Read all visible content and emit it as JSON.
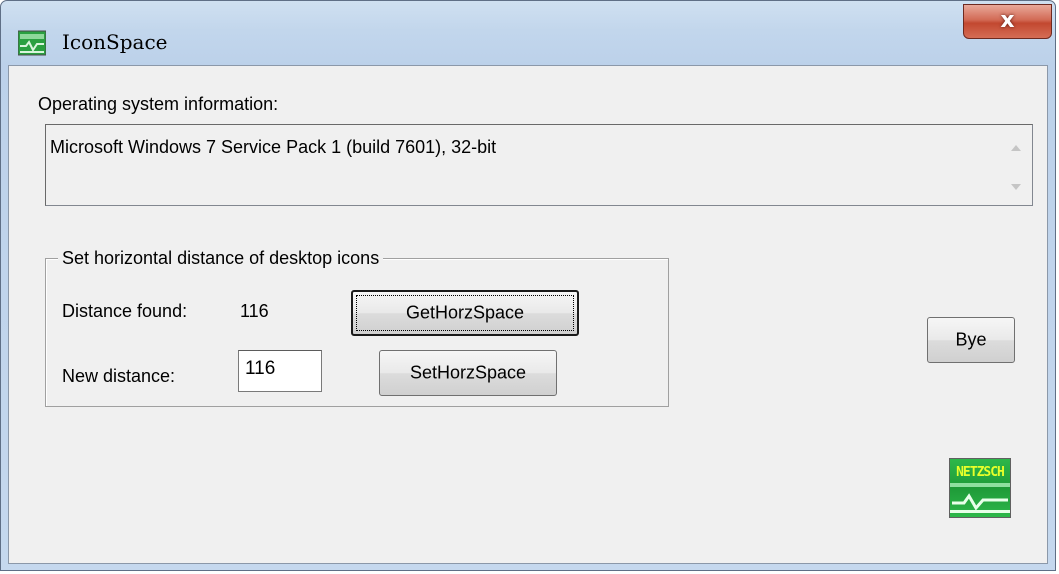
{
  "window": {
    "title": "IconSpace",
    "close_label": "x"
  },
  "os_info": {
    "label": "Operating system information:",
    "value": "Microsoft Windows 7  Service Pack 1 (build 7601), 32-bit"
  },
  "group": {
    "legend": "Set horizontal distance of desktop icons",
    "distance_found_label": "Distance found:",
    "distance_found_value": "116",
    "get_button": "GetHorzSpace",
    "new_distance_label": "New distance:",
    "new_distance_value": "116",
    "set_button": "SetHorzSpace"
  },
  "bye_button": "Bye",
  "logo": {
    "text": "NETZSCH"
  },
  "icons": {
    "app": "app-icon",
    "close": "close-icon",
    "scroll_up": "scroll-up-arrow-icon",
    "scroll_down": "scroll-down-arrow-icon",
    "logo": "netzsch-logo"
  },
  "colors": {
    "titlebar": "#c2d6ec",
    "client": "#f0f0f0",
    "close_button": "#c24830",
    "logo_green": "#2db84a",
    "logo_text": "#e8ff2a"
  }
}
